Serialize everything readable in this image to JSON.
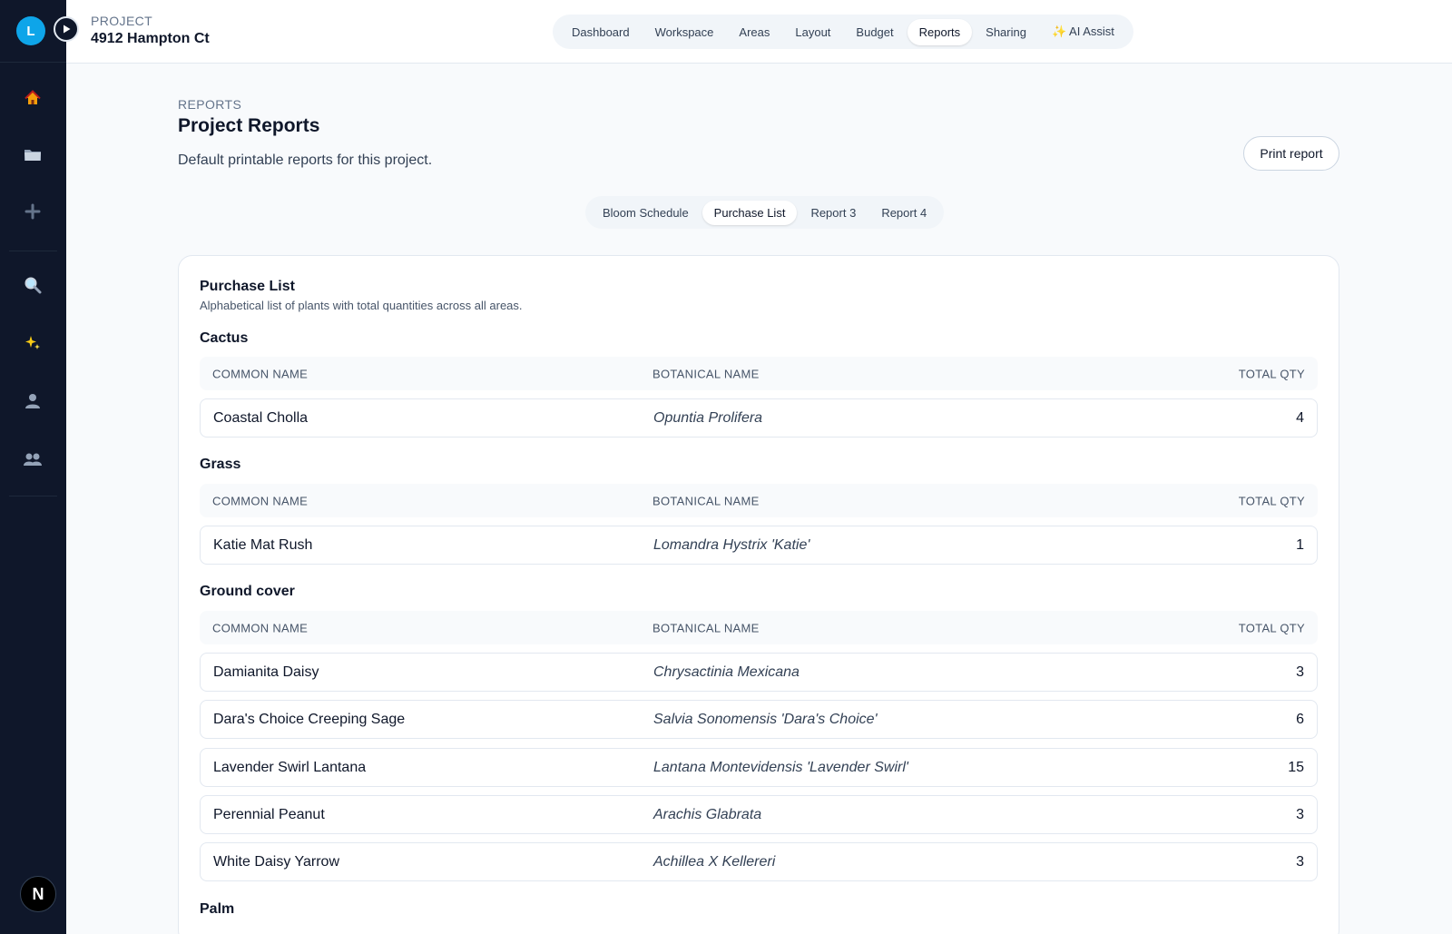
{
  "sidebar": {
    "avatar_initial": "L",
    "icons": [
      "home-icon",
      "folder-icon",
      "plus-icon",
      "search-icon",
      "sparkles-icon",
      "user-icon",
      "users-icon"
    ],
    "bottom_badge": "N"
  },
  "header": {
    "project_label": "PROJECT",
    "project_name": "4912 Hampton Ct",
    "nav": [
      "Dashboard",
      "Workspace",
      "Areas",
      "Layout",
      "Budget",
      "Reports",
      "Sharing",
      "✨ AI Assist"
    ],
    "active_nav": "Reports"
  },
  "page": {
    "section_label": "REPORTS",
    "title": "Project Reports",
    "description": "Default printable reports for this project.",
    "print_button": "Print report",
    "tabs": [
      "Bloom Schedule",
      "Purchase List",
      "Report 3",
      "Report 4"
    ],
    "active_tab": "Purchase List"
  },
  "report": {
    "title": "Purchase List",
    "description": "Alphabetical list of plants with total quantities across all areas.",
    "columns": [
      "COMMON NAME",
      "BOTANICAL NAME",
      "TOTAL QTY"
    ],
    "groups": [
      {
        "name": "Cactus",
        "rows": [
          {
            "common": "Coastal Cholla",
            "botanical": "Opuntia Prolifera",
            "qty": "4"
          }
        ]
      },
      {
        "name": "Grass",
        "rows": [
          {
            "common": "Katie Mat Rush",
            "botanical": "Lomandra Hystrix 'Katie'",
            "qty": "1"
          }
        ]
      },
      {
        "name": "Ground cover",
        "rows": [
          {
            "common": "Damianita Daisy",
            "botanical": "Chrysactinia Mexicana",
            "qty": "3"
          },
          {
            "common": "Dara's Choice Creeping Sage",
            "botanical": "Salvia Sonomensis 'Dara's Choice'",
            "qty": "6"
          },
          {
            "common": "Lavender Swirl Lantana",
            "botanical": "Lantana Montevidensis 'Lavender Swirl'",
            "qty": "15"
          },
          {
            "common": "Perennial Peanut",
            "botanical": "Arachis Glabrata",
            "qty": "3"
          },
          {
            "common": "White Daisy Yarrow",
            "botanical": "Achillea X Kellereri",
            "qty": "3"
          }
        ]
      },
      {
        "name": "Palm",
        "rows": []
      }
    ]
  }
}
